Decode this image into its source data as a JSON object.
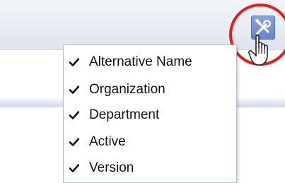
{
  "toolbar": {
    "settings_button": {
      "icon": "wrench-screwdriver-icon"
    }
  },
  "column_menu": {
    "items": [
      {
        "label": "Alternative Name",
        "checked": true,
        "icon": "check-icon"
      },
      {
        "label": "Organization",
        "checked": true,
        "icon": "check-icon"
      },
      {
        "label": "Department",
        "checked": true,
        "icon": "check-icon"
      },
      {
        "label": "Active",
        "checked": true,
        "icon": "check-icon"
      },
      {
        "label": "Version",
        "checked": true,
        "icon": "check-icon"
      }
    ]
  },
  "colors": {
    "toolbar_bg": "#e8ecf3",
    "settings_button_bg": "#6a84c8",
    "highlight_ring": "#e21d1d",
    "menu_border": "#b5bfcf"
  }
}
